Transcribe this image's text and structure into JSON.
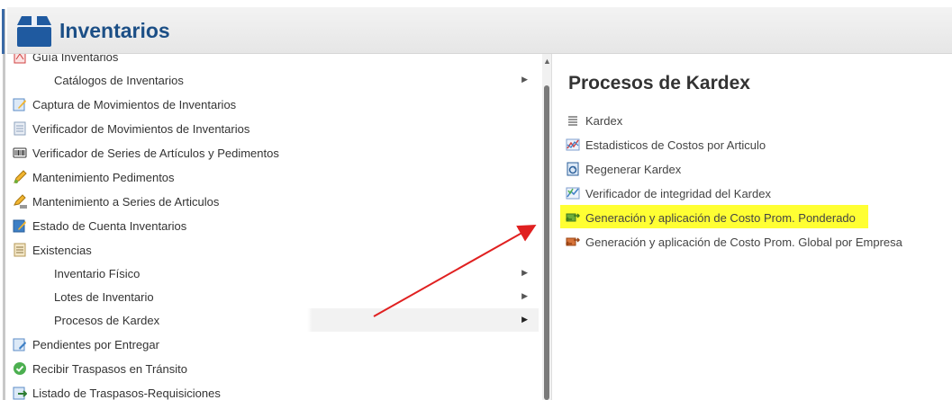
{
  "app": {
    "title": "Inventarios"
  },
  "left_menu": {
    "items": [
      {
        "label": "Guía Inventarios",
        "icon": "pdf-icon",
        "sub": false,
        "submenu": false
      },
      {
        "label": "Catálogos de Inventarios",
        "icon": "",
        "sub": true,
        "submenu": true
      },
      {
        "label": "Captura de Movimientos de Inventarios",
        "icon": "edit-form-icon",
        "sub": false,
        "submenu": false
      },
      {
        "label": "Verificador de Movimientos de Inventarios",
        "icon": "document-icon",
        "sub": false,
        "submenu": false
      },
      {
        "label": "Verificador de Series de Artículos y Pedimentos",
        "icon": "barcode-icon",
        "sub": false,
        "submenu": false
      },
      {
        "label": "Mantenimiento Pedimentos",
        "icon": "pencil-icon",
        "sub": false,
        "submenu": false
      },
      {
        "label": "Mantenimiento a Series de Articulos",
        "icon": "pencil-barcode-icon",
        "sub": false,
        "submenu": false
      },
      {
        "label": "Estado de Cuenta Inventarios",
        "icon": "edit-form-icon",
        "sub": false,
        "submenu": false
      },
      {
        "label": "Existencias",
        "icon": "list-doc-icon",
        "sub": false,
        "submenu": false
      },
      {
        "label": "Inventario Físico",
        "icon": "",
        "sub": true,
        "submenu": true
      },
      {
        "label": "Lotes de Inventario",
        "icon": "",
        "sub": true,
        "submenu": true
      },
      {
        "label": "Procesos de Kardex",
        "icon": "",
        "sub": true,
        "submenu": true
      },
      {
        "label": "Pendientes por Entregar",
        "icon": "edit-doc-icon",
        "sub": false,
        "submenu": false
      },
      {
        "label": "Recibir Traspasos en Tránsito",
        "icon": "check-circle-icon",
        "sub": false,
        "submenu": false
      },
      {
        "label": "Listado de Traspasos-Requisiciones",
        "icon": "transfer-icon",
        "sub": false,
        "submenu": false
      }
    ]
  },
  "right_panel": {
    "heading": "Procesos de Kardex",
    "items": [
      {
        "label": "Kardex",
        "icon": "lines-icon"
      },
      {
        "label": "Estadisticos de Costos por Articulo",
        "icon": "chart-icon"
      },
      {
        "label": "Regenerar Kardex",
        "icon": "refresh-doc-icon"
      },
      {
        "label": "Verificador de integridad del Kardex",
        "icon": "verify-chart-icon"
      },
      {
        "label": "Generación y aplicación de Costo Prom. Ponderado",
        "icon": "money-arrows-icon"
      },
      {
        "label": "Generación y aplicación de Costo Prom. Global por Empresa",
        "icon": "money-arrows-red-icon"
      }
    ]
  },
  "colors": {
    "highlight": "#ffff33",
    "title_blue": "#1c4f86",
    "annotation_arrow": "#e02020"
  }
}
